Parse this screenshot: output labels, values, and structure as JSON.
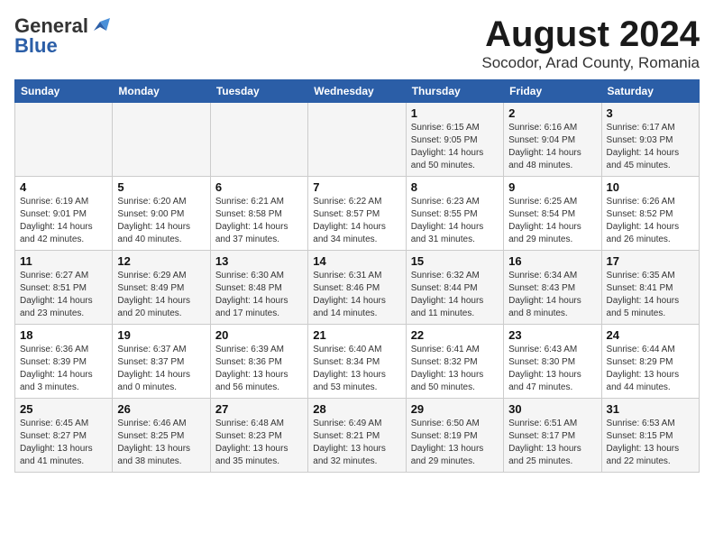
{
  "header": {
    "logo_line1_general": "General",
    "logo_line1_blue": "Blue",
    "main_title": "August 2024",
    "subtitle": "Socodor, Arad County, Romania"
  },
  "columns": [
    "Sunday",
    "Monday",
    "Tuesday",
    "Wednesday",
    "Thursday",
    "Friday",
    "Saturday"
  ],
  "weeks": [
    [
      {
        "day": "",
        "info": ""
      },
      {
        "day": "",
        "info": ""
      },
      {
        "day": "",
        "info": ""
      },
      {
        "day": "",
        "info": ""
      },
      {
        "day": "1",
        "info": "Sunrise: 6:15 AM\nSunset: 9:05 PM\nDaylight: 14 hours and 50 minutes."
      },
      {
        "day": "2",
        "info": "Sunrise: 6:16 AM\nSunset: 9:04 PM\nDaylight: 14 hours and 48 minutes."
      },
      {
        "day": "3",
        "info": "Sunrise: 6:17 AM\nSunset: 9:03 PM\nDaylight: 14 hours and 45 minutes."
      }
    ],
    [
      {
        "day": "4",
        "info": "Sunrise: 6:19 AM\nSunset: 9:01 PM\nDaylight: 14 hours and 42 minutes."
      },
      {
        "day": "5",
        "info": "Sunrise: 6:20 AM\nSunset: 9:00 PM\nDaylight: 14 hours and 40 minutes."
      },
      {
        "day": "6",
        "info": "Sunrise: 6:21 AM\nSunset: 8:58 PM\nDaylight: 14 hours and 37 minutes."
      },
      {
        "day": "7",
        "info": "Sunrise: 6:22 AM\nSunset: 8:57 PM\nDaylight: 14 hours and 34 minutes."
      },
      {
        "day": "8",
        "info": "Sunrise: 6:23 AM\nSunset: 8:55 PM\nDaylight: 14 hours and 31 minutes."
      },
      {
        "day": "9",
        "info": "Sunrise: 6:25 AM\nSunset: 8:54 PM\nDaylight: 14 hours and 29 minutes."
      },
      {
        "day": "10",
        "info": "Sunrise: 6:26 AM\nSunset: 8:52 PM\nDaylight: 14 hours and 26 minutes."
      }
    ],
    [
      {
        "day": "11",
        "info": "Sunrise: 6:27 AM\nSunset: 8:51 PM\nDaylight: 14 hours and 23 minutes."
      },
      {
        "day": "12",
        "info": "Sunrise: 6:29 AM\nSunset: 8:49 PM\nDaylight: 14 hours and 20 minutes."
      },
      {
        "day": "13",
        "info": "Sunrise: 6:30 AM\nSunset: 8:48 PM\nDaylight: 14 hours and 17 minutes."
      },
      {
        "day": "14",
        "info": "Sunrise: 6:31 AM\nSunset: 8:46 PM\nDaylight: 14 hours and 14 minutes."
      },
      {
        "day": "15",
        "info": "Sunrise: 6:32 AM\nSunset: 8:44 PM\nDaylight: 14 hours and 11 minutes."
      },
      {
        "day": "16",
        "info": "Sunrise: 6:34 AM\nSunset: 8:43 PM\nDaylight: 14 hours and 8 minutes."
      },
      {
        "day": "17",
        "info": "Sunrise: 6:35 AM\nSunset: 8:41 PM\nDaylight: 14 hours and 5 minutes."
      }
    ],
    [
      {
        "day": "18",
        "info": "Sunrise: 6:36 AM\nSunset: 8:39 PM\nDaylight: 14 hours and 3 minutes."
      },
      {
        "day": "19",
        "info": "Sunrise: 6:37 AM\nSunset: 8:37 PM\nDaylight: 14 hours and 0 minutes."
      },
      {
        "day": "20",
        "info": "Sunrise: 6:39 AM\nSunset: 8:36 PM\nDaylight: 13 hours and 56 minutes."
      },
      {
        "day": "21",
        "info": "Sunrise: 6:40 AM\nSunset: 8:34 PM\nDaylight: 13 hours and 53 minutes."
      },
      {
        "day": "22",
        "info": "Sunrise: 6:41 AM\nSunset: 8:32 PM\nDaylight: 13 hours and 50 minutes."
      },
      {
        "day": "23",
        "info": "Sunrise: 6:43 AM\nSunset: 8:30 PM\nDaylight: 13 hours and 47 minutes."
      },
      {
        "day": "24",
        "info": "Sunrise: 6:44 AM\nSunset: 8:29 PM\nDaylight: 13 hours and 44 minutes."
      }
    ],
    [
      {
        "day": "25",
        "info": "Sunrise: 6:45 AM\nSunset: 8:27 PM\nDaylight: 13 hours and 41 minutes."
      },
      {
        "day": "26",
        "info": "Sunrise: 6:46 AM\nSunset: 8:25 PM\nDaylight: 13 hours and 38 minutes."
      },
      {
        "day": "27",
        "info": "Sunrise: 6:48 AM\nSunset: 8:23 PM\nDaylight: 13 hours and 35 minutes."
      },
      {
        "day": "28",
        "info": "Sunrise: 6:49 AM\nSunset: 8:21 PM\nDaylight: 13 hours and 32 minutes."
      },
      {
        "day": "29",
        "info": "Sunrise: 6:50 AM\nSunset: 8:19 PM\nDaylight: 13 hours and 29 minutes."
      },
      {
        "day": "30",
        "info": "Sunrise: 6:51 AM\nSunset: 8:17 PM\nDaylight: 13 hours and 25 minutes."
      },
      {
        "day": "31",
        "info": "Sunrise: 6:53 AM\nSunset: 8:15 PM\nDaylight: 13 hours and 22 minutes."
      }
    ]
  ]
}
